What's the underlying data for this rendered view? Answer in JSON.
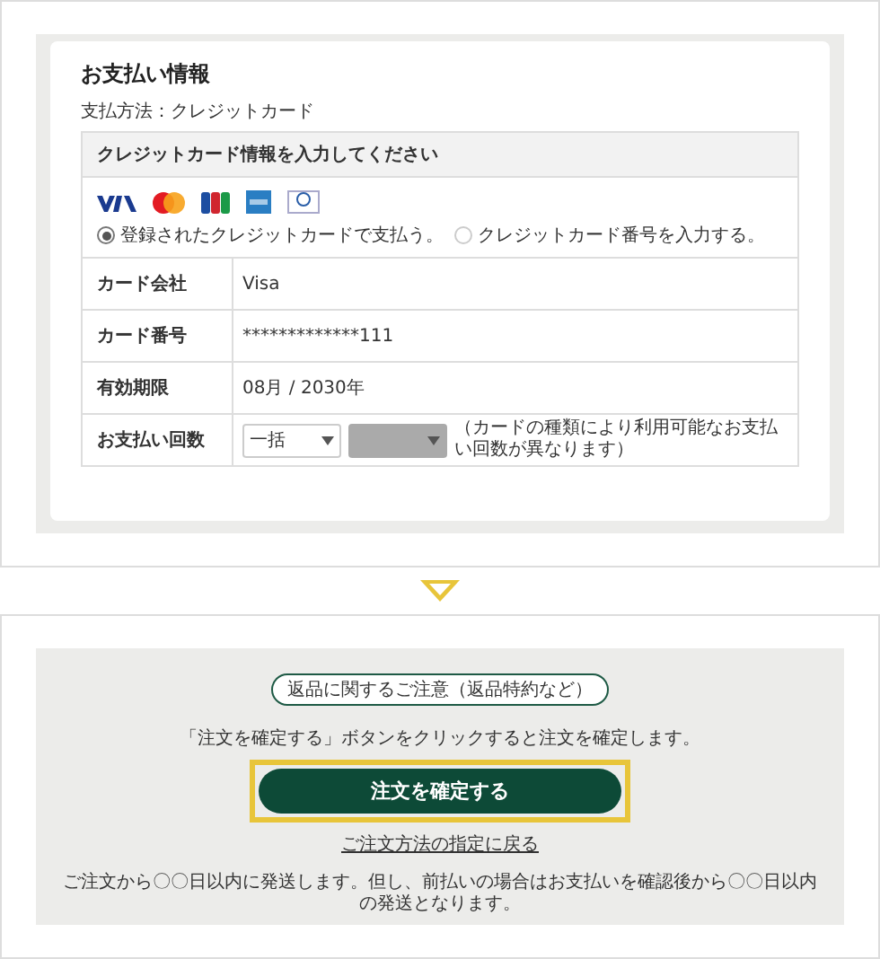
{
  "payment": {
    "title": "お支払い情報",
    "method": "支払方法：クレジットカード",
    "panel_title": "クレジットカード情報を入力してください",
    "cards": [
      {
        "kind": "visa"
      },
      {
        "kind": "master"
      },
      {
        "kind": "jcb"
      },
      {
        "kind": "amex"
      },
      {
        "kind": "diners"
      }
    ],
    "options": [
      {
        "label": "登録されたクレジットカードで支払う。",
        "selected": true
      },
      {
        "label": "クレジットカード番号を入力する。",
        "selected": false
      }
    ],
    "rows": [
      {
        "label": "カード会社",
        "value": "Visa"
      },
      {
        "label": "カード番号",
        "value": "*************111"
      },
      {
        "label": "有効期限",
        "value": "08月 / 2030年"
      }
    ],
    "installments": {
      "label": "お支払い回数",
      "select_value": "一括",
      "second_disabled": true,
      "note": "（カードの種類により利用可能なお支払い回数が異なります）"
    }
  },
  "confirm": {
    "notice": "返品に関するご注意（返品特約など）",
    "instruction": "「注文を確定する」ボタンをクリックすると注文を確定します。",
    "button": "注文を確定する",
    "back_link": "ご注文方法の指定に戻る",
    "shipping_note": "ご注文から〇〇日以内に発送します。但し、前払いの場合はお支払いを確認後から〇〇日以内の発送となります。"
  }
}
